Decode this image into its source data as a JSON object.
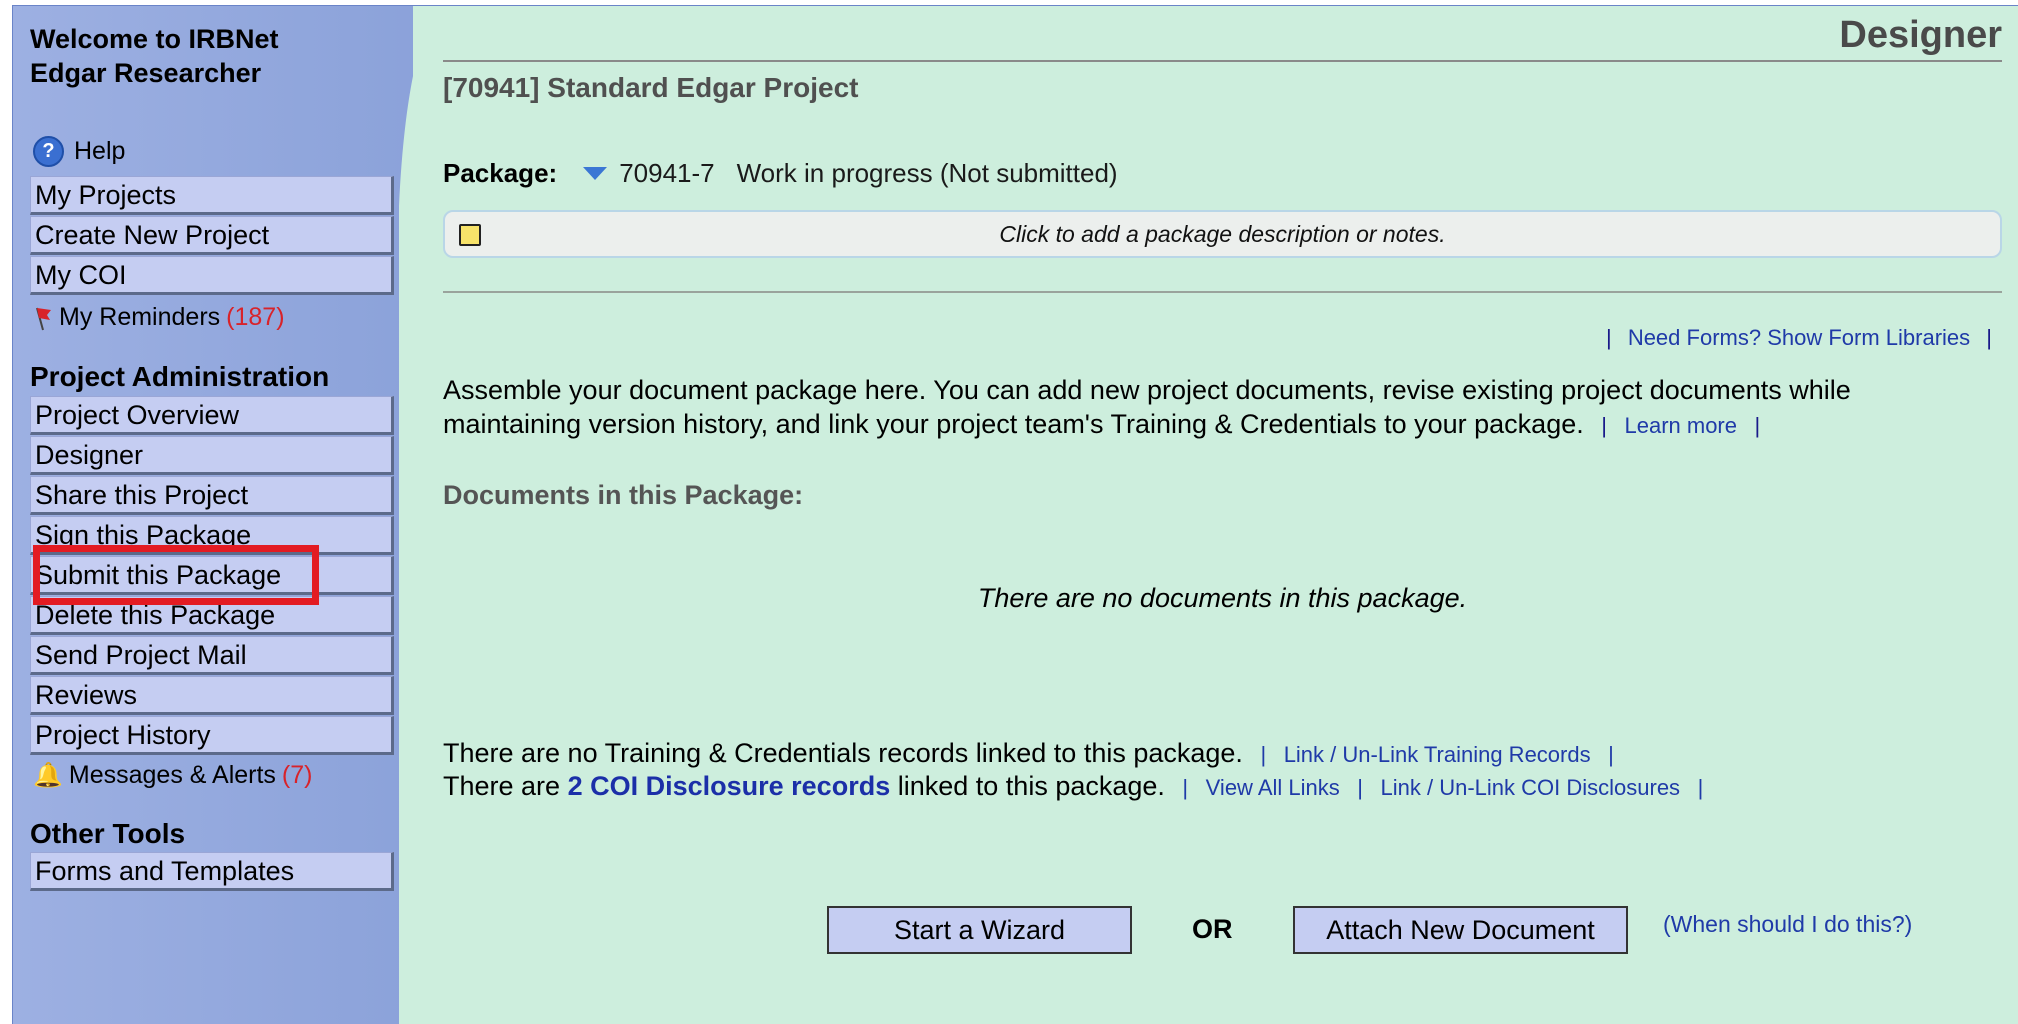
{
  "sidebar": {
    "welcome_line1": "Welcome to IRBNet",
    "welcome_line2": "Edgar Researcher",
    "help_label": "Help",
    "nav_items": [
      {
        "label": "My Projects"
      },
      {
        "label": "Create New Project"
      },
      {
        "label": "My COI"
      }
    ],
    "reminders": {
      "label": "My Reminders",
      "count": "(187)"
    },
    "project_admin_title": "Project Administration",
    "project_admin_items": [
      {
        "label": "Project Overview"
      },
      {
        "label": "Designer"
      },
      {
        "label": "Share this Project"
      },
      {
        "label": "Sign this Package"
      },
      {
        "label": "Submit this Package"
      },
      {
        "label": "Delete this Package"
      },
      {
        "label": "Send Project Mail"
      },
      {
        "label": "Reviews"
      },
      {
        "label": "Project History"
      }
    ],
    "messages": {
      "label": "Messages & Alerts",
      "count": "(7)"
    },
    "other_tools_title": "Other Tools",
    "other_tools_items": [
      {
        "label": "Forms and Templates"
      }
    ],
    "highlight_color": "#e31b23"
  },
  "main": {
    "page_title": "Designer",
    "project_title": "[70941] Standard Edgar Project",
    "package_label": "Package:",
    "package_id": "70941-7",
    "package_status": "Work in progress (Not submitted)",
    "notes_placeholder": "Click to add a package description or notes.",
    "forms_link": "Need Forms? Show Form Libraries",
    "assemble_text": "Assemble your document package here. You can add new project documents, revise existing project documents while maintaining version history, and link your project team's Training & Credentials to your package.",
    "learn_more": "Learn more",
    "documents_header": "Documents in this Package:",
    "no_documents": "There are no documents in this package.",
    "training_text": "There are no Training & Credentials records linked to this package.",
    "training_link": "Link / Un-Link Training Records",
    "coi_prefix": "There are",
    "coi_records": "2 COI Disclosure records",
    "coi_suffix": "linked to this package.",
    "view_all_links": "View All Links",
    "coi_link": "Link / Un-Link COI Disclosures",
    "start_wizard": "Start a Wizard",
    "or_label": "OR",
    "attach_document": "Attach New Document",
    "when_link": "(When should I do this?)"
  },
  "colors": {
    "sidebar": "#8fa6dc",
    "content_bg": "#cdeedd",
    "nav_item": "#c5cdf2",
    "link": "#1f3aa8"
  }
}
